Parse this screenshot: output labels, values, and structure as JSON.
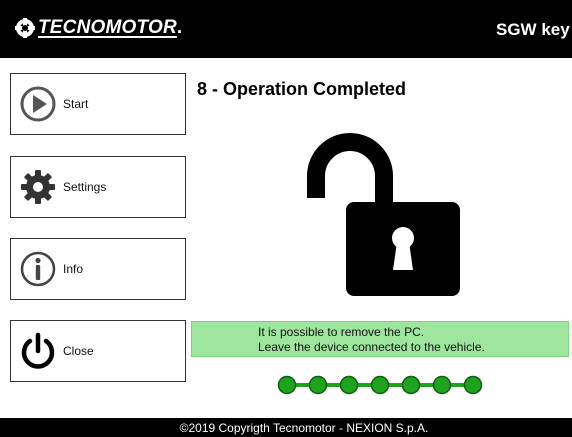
{
  "header": {
    "logo_text": "TECNOMOTOR",
    "logo_suffix": ".",
    "title": "SGW key"
  },
  "nav": {
    "start_label": "Start",
    "settings_label": "Settings",
    "info_label": "Info",
    "close_label": "Close"
  },
  "main": {
    "title": "8 - Operation Completed",
    "status_line1": "It is possible to remove the PC.",
    "status_line2": "Leave the device connected to the vehicle."
  },
  "progress": {
    "steps_total": 7,
    "steps_completed": 7,
    "color": "#1fa31f"
  },
  "footer": {
    "copyright": "©2019 Copyrigth Tecnomotor - NEXION S.p.A."
  },
  "colors": {
    "status_bg": "#9ee59e",
    "header_bg": "#000000"
  }
}
